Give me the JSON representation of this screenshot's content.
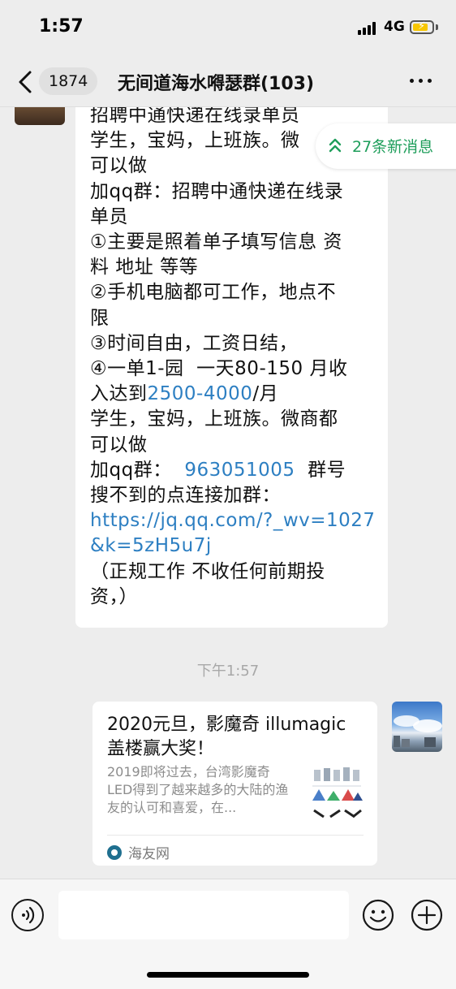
{
  "status_bar": {
    "time": "1:57",
    "network": "4G",
    "signal_icon": "signal-bars-icon",
    "battery_icon": "battery-charging-icon"
  },
  "nav": {
    "back_icon": "chevron-left-icon",
    "unread_count": "1874",
    "title": "无间道海水嘚瑟群(103)",
    "more_icon": "more-dots-icon"
  },
  "new_messages": {
    "label": "27条新消息",
    "icon": "double-chevron-up-icon",
    "color": "#1f9e5b"
  },
  "incoming_message": {
    "lines": [
      {
        "text": "招聘中通快递在线录单员"
      },
      {
        "text": "学生，宝妈，上班族。微"
      },
      {
        "text": "可以做"
      },
      {
        "text": "加qq群：招聘中通快递在线录"
      },
      {
        "text": "单员"
      },
      {
        "text": "①主要是照着单子填写信息 资"
      },
      {
        "text": "料 地址 等等"
      },
      {
        "text": "②手机电脑都可工作，地点不"
      },
      {
        "text": "限"
      },
      {
        "text": "③时间自由，工资日结，"
      },
      {
        "text": "④一单1-园  一天80-150 月收"
      },
      {
        "text": "入达到",
        "link": "2500-4000",
        "after": "/月"
      },
      {
        "text": "学生，宝妈，上班族。微商都"
      },
      {
        "text": "可以做"
      },
      {
        "text": "加qq群：  ",
        "link": "963051005",
        "after": "  群号"
      },
      {
        "text": "搜不到的点连接加群："
      },
      {
        "link": "https://jq.qq.com/?_wv=1027"
      },
      {
        "link": "&k=5zH5u7j"
      },
      {
        "text": "（正规工作 不收任何前期投"
      },
      {
        "text": "资，）"
      }
    ],
    "link_color": "#2d7fc2"
  },
  "timestamp": "下午1:57",
  "link_card": {
    "title": "2020元旦，影魔奇 illumagic 盖楼赢大奖！",
    "description": "2019即将过去，台湾影魔奇LED得到了越来越多的大陆的渔友的认可和喜爱，在...",
    "source": "海友网",
    "source_icon": "source-logo-icon"
  },
  "input_bar": {
    "voice_icon": "voice-icon",
    "emoji_icon": "emoji-icon",
    "plus_icon": "plus-icon",
    "placeholder": ""
  }
}
